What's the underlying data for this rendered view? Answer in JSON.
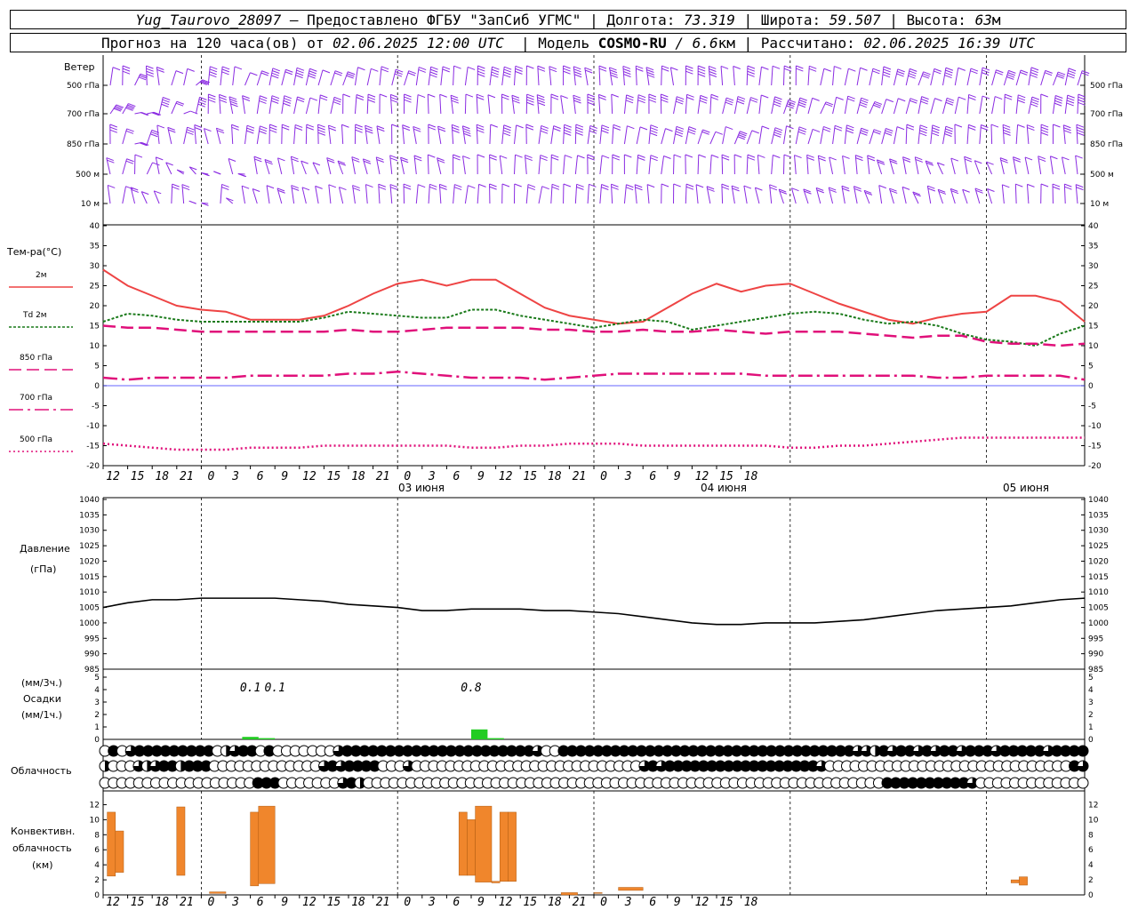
{
  "header": {
    "station": "Yug_Taurovo_28097",
    "provider": " – Предоставлено ФГБУ \"ЗапСиб УГМС\" | Долгота: ",
    "lon": "73.319",
    "lat_label": " | Широта: ",
    "lat": "59.507",
    "alt_label": " | Высота: ",
    "alt": "63",
    "alt_unit": "м",
    "forecast_label": "Прогноз на 120 часа(ов) от ",
    "forecast_from": "02.06.2025 12:00 UTC",
    "model_label": "  | Модель ",
    "model": "COSMO-RU",
    "resolution": " / 6.6",
    "res_unit": "км",
    "calc_label": " | Рассчитано: ",
    "calc_time": "02.06.2025 16:39 UTC"
  },
  "panels": {
    "wind": {
      "title": "Ветер",
      "levels": [
        "500 гПа",
        "700 гПа",
        "850 гПа",
        "500 м",
        "10  м"
      ]
    },
    "temp": {
      "title": "Тем-ра(°С)",
      "legend": [
        {
          "label": "2м",
          "color": "#ee4444",
          "style": "solid"
        },
        {
          "label": "Td  2м",
          "color": "#1a7a1a",
          "style": "dot"
        },
        {
          "label": "850 гПа",
          "color": "#e0107a",
          "style": "dash"
        },
        {
          "label": "700 гПа",
          "color": "#e0107a",
          "style": "dashdot"
        },
        {
          "label": "500 гПа",
          "color": "#e0107a",
          "style": "dotted"
        }
      ]
    },
    "pressure": {
      "title1": "Давление",
      "title2": "(гПа)"
    },
    "precip": {
      "title1": "(мм/3ч.)",
      "title2": "Осадки",
      "title3": "(мм/1ч.)"
    },
    "clouds": {
      "title": "Облачность"
    },
    "conv": {
      "title1": "Конвективн.",
      "title2": "облачность",
      "title3": "(км)"
    }
  },
  "x_hours": [
    "12",
    "15",
    "18",
    "21",
    "0",
    "3",
    "6",
    "9",
    "12",
    "15",
    "18",
    "21",
    "0",
    "3",
    "6",
    "9",
    "12",
    "15",
    "18",
    "21",
    "0",
    "3",
    "6",
    "9",
    "12",
    "15",
    "18"
  ],
  "date_labels": [
    "03 июня",
    "04 июня",
    "05 июня"
  ],
  "chart_data": [
    {
      "type": "line",
      "title": "Тем-ра(°С)",
      "ylim": [
        -20,
        40
      ],
      "yticks": [
        40,
        35,
        30,
        25,
        20,
        15,
        10,
        5,
        0,
        -5,
        -10,
        -15,
        -20
      ],
      "x_hours_from_start": [
        0,
        3,
        6,
        9,
        12,
        15,
        18,
        21,
        24,
        27,
        30,
        33,
        36,
        39,
        42,
        45,
        48,
        51,
        54,
        57,
        60,
        63,
        66,
        69,
        72,
        75,
        78,
        81,
        84,
        87,
        90,
        93,
        96,
        99,
        102,
        105,
        108,
        111,
        114,
        117,
        120
      ],
      "series": [
        {
          "name": "2м",
          "values": [
            29,
            25,
            22.5,
            20,
            19,
            18.5,
            16.5,
            16.5,
            16.5,
            17.5,
            20,
            23,
            25.5,
            26.5,
            25,
            26.5,
            26.5,
            23,
            19.5,
            17.5,
            16.5,
            15.5,
            16,
            19.5,
            23,
            25.5,
            23.5,
            25,
            25.5,
            23,
            20.5,
            18.5,
            16.5,
            15.5,
            17,
            18,
            18.5,
            22.5,
            22.5,
            21,
            16
          ]
        },
        {
          "name": "Td  2м",
          "values": [
            16,
            18,
            17.5,
            16.5,
            16,
            16,
            16,
            16,
            16,
            17,
            18.5,
            18,
            17.5,
            17,
            17,
            19,
            19,
            17.5,
            16.5,
            15.5,
            14.5,
            15.5,
            16.5,
            16,
            14,
            15,
            16,
            17,
            18,
            18.5,
            18,
            16.5,
            15.5,
            16,
            15,
            13,
            11.5,
            11,
            10,
            13,
            15
          ]
        },
        {
          "name": "850 гПа",
          "values": [
            15,
            14.5,
            14.5,
            14,
            13.5,
            13.5,
            13.5,
            13.5,
            13.5,
            13.5,
            14,
            13.5,
            13.5,
            14,
            14.5,
            14.5,
            14.5,
            14.5,
            14,
            14,
            13.5,
            13.5,
            14,
            13.5,
            13.5,
            14,
            13.5,
            13,
            13.5,
            13.5,
            13.5,
            13,
            12.5,
            12,
            12.5,
            12.5,
            11,
            10.5,
            10.5,
            10,
            10.5
          ]
        },
        {
          "name": "700 гПа",
          "values": [
            2,
            1.5,
            2,
            2,
            2,
            2,
            2.5,
            2.5,
            2.5,
            2.5,
            3,
            3,
            3.5,
            3,
            2.5,
            2,
            2,
            2,
            1.5,
            2,
            2.5,
            3,
            3,
            3,
            3,
            3,
            3,
            2.5,
            2.5,
            2.5,
            2.5,
            2.5,
            2.5,
            2.5,
            2,
            2,
            2.5,
            2.5,
            2.5,
            2.5,
            1.5
          ]
        },
        {
          "name": "500 гПа",
          "values": [
            -14.5,
            -15,
            -15.5,
            -16,
            -16,
            -16,
            -15.5,
            -15.5,
            -15.5,
            -15,
            -15,
            -15,
            -15,
            -15,
            -15,
            -15.5,
            -15.5,
            -15,
            -15,
            -14.5,
            -14.5,
            -14.5,
            -15,
            -15,
            -15,
            -15,
            -15,
            -15,
            -15.5,
            -15.5,
            -15,
            -15,
            -14.5,
            -14,
            -13.5,
            -13,
            -13,
            -13,
            -13,
            -13,
            -13
          ]
        }
      ]
    },
    {
      "type": "line",
      "title": "Давление",
      "ylim": [
        985,
        1040
      ],
      "yticks": [
        1040,
        1035,
        1030,
        1025,
        1020,
        1015,
        1010,
        1005,
        1000,
        995,
        990,
        985
      ],
      "x_hours_from_start": [
        0,
        3,
        6,
        9,
        12,
        15,
        18,
        21,
        24,
        27,
        30,
        33,
        36,
        39,
        42,
        45,
        48,
        51,
        54,
        57,
        60,
        63,
        66,
        69,
        72,
        75,
        78,
        81,
        84,
        87,
        90,
        93,
        96,
        99,
        102,
        105,
        108,
        111,
        114,
        117,
        120
      ],
      "series": [
        {
          "name": "P",
          "values": [
            1005,
            1006.5,
            1007.5,
            1007.5,
            1008,
            1008,
            1008,
            1008,
            1007.5,
            1007,
            1006,
            1005.5,
            1005,
            1004,
            1004,
            1004.5,
            1004.5,
            1004.5,
            1004,
            1004,
            1003.5,
            1003,
            1002,
            1001,
            1000,
            999.5,
            999.5,
            1000,
            1000,
            1000,
            1000.5,
            1001,
            1002,
            1003,
            1004,
            1004.5,
            1005,
            1005.5,
            1006.5,
            1007.5,
            1008
          ]
        }
      ]
    },
    {
      "type": "bar",
      "title": "Осадки",
      "ylim": [
        0,
        5
      ],
      "yticks": [
        5,
        4,
        3,
        2,
        1,
        0
      ],
      "bars_hours": [
        [
          17,
          19,
          0.2
        ],
        [
          19,
          21,
          0.1
        ],
        [
          45,
          47,
          0.8
        ],
        [
          47,
          49,
          0.1
        ]
      ],
      "data_labels": [
        {
          "hour": 18,
          "text": "0.1"
        },
        {
          "hour": 21,
          "text": "0.1"
        },
        {
          "hour": 45,
          "text": "0.8"
        }
      ]
    },
    {
      "type": "bar",
      "title": "Конвективн. облачность",
      "ylim": [
        0,
        13
      ],
      "yticks": [
        12,
        10,
        8,
        6,
        4,
        2,
        0
      ],
      "bars_hours": [
        [
          0.5,
          1.5,
          2.5,
          11
        ],
        [
          1.5,
          2.5,
          3,
          8.5
        ],
        [
          9,
          10,
          2.6,
          11.7
        ],
        [
          13,
          15,
          0.2,
          0.4
        ],
        [
          18,
          19,
          1.2,
          11
        ],
        [
          19,
          21,
          1.5,
          11.8
        ],
        [
          43.5,
          44.5,
          2.6,
          11
        ],
        [
          44.5,
          45.5,
          2.6,
          10
        ],
        [
          45.5,
          47.5,
          1.7,
          11.8
        ],
        [
          47.5,
          48.5,
          1.6,
          1.8
        ],
        [
          48.5,
          49.5,
          1.8,
          11
        ],
        [
          49.5,
          50.5,
          1.8,
          11
        ],
        [
          56,
          58,
          0,
          0.3
        ],
        [
          60,
          61,
          0.2,
          0.3
        ],
        [
          63,
          66,
          0.6,
          1
        ],
        [
          111,
          112,
          1.6,
          2
        ],
        [
          112,
          113,
          1.3,
          2.4
        ]
      ]
    }
  ],
  "cloud_rows": [
    "0H0QHHHHHHHHH0TQHH0H0000000QHHHHHHHHHHHHHHHHHHHHHHQ00HHHHHHHHHHHHHHHHHHHHHHHHHHHHHHHHHHQQTHQHHQHQHHQHHHQHHHHHQHHHH",
    "T000QTQHHTHHH0000000000000QHQHHHH000Q000000000000000000000000000QHQHHHHHHHHHHHHHHHHHHQ00000000000000000000000000000HQ",
    "000000000000000000HHH0000000QHT0000000000000000000000000000000000000000000000000000000000000HHHHHHHHHHQ0000000000000"
  ]
}
